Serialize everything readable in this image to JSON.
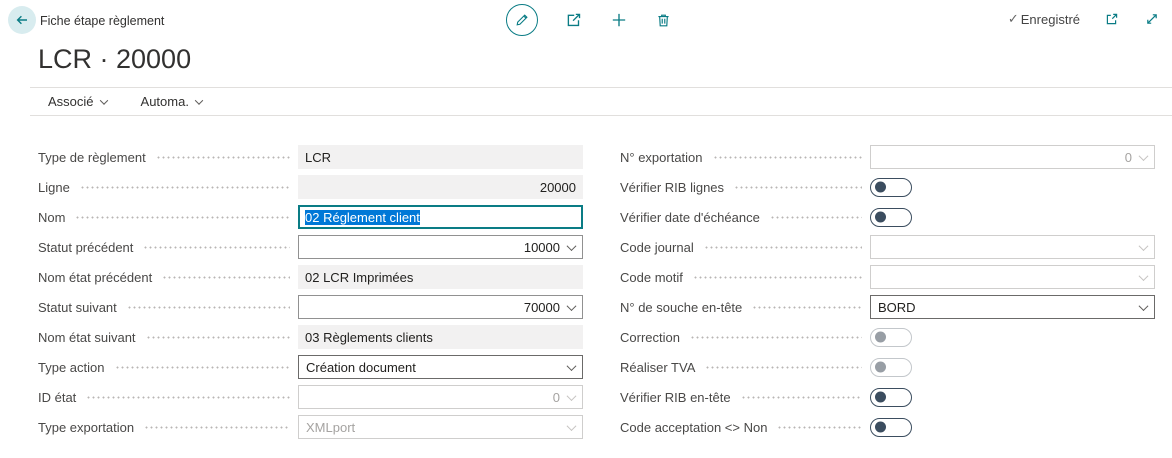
{
  "colors": {
    "accent_teal": "#0a7c85",
    "selection_blue": "#0078d7",
    "toggle_dark": "#3b4d5f",
    "readonly_bg": "#f2f1f1"
  },
  "header": {
    "caption": "Fiche étape règlement",
    "saved_label": "Enregistré",
    "icons": [
      "back-arrow-icon",
      "edit-pencil-icon",
      "share-icon",
      "plus-icon",
      "trash-icon",
      "check-icon",
      "popout-window-icon",
      "expand-diagonal-icon"
    ]
  },
  "page": {
    "title": "LCR · 20000"
  },
  "menu": {
    "items": [
      {
        "label": "Associé"
      },
      {
        "label": "Automa."
      }
    ]
  },
  "fields": {
    "left": [
      {
        "label": "Type de règlement",
        "value": "LCR",
        "type": "readonly"
      },
      {
        "label": "Ligne",
        "value": "20000",
        "type": "readonly",
        "align": "right"
      },
      {
        "label": "Nom",
        "value": "02 Réglement client",
        "type": "text",
        "state": "focused-selected"
      },
      {
        "label": "Statut précédent",
        "value": "10000",
        "type": "combo",
        "align": "right"
      },
      {
        "label": "Nom état précédent",
        "value": "02 LCR Imprimées",
        "type": "readonly"
      },
      {
        "label": "Statut suivant",
        "value": "70000",
        "type": "combo",
        "align": "right"
      },
      {
        "label": "Nom état suivant",
        "value": "03 Règlements clients",
        "type": "readonly"
      },
      {
        "label": "Type action",
        "value": "Création document",
        "type": "combo"
      },
      {
        "label": "ID état",
        "value": "0",
        "type": "combo",
        "align": "right",
        "disabled": true
      },
      {
        "label": "Type exportation",
        "value": "XMLport",
        "type": "combo",
        "disabled": true
      }
    ],
    "right": [
      {
        "label": "N° exportation",
        "value": "0",
        "type": "combo",
        "align": "right",
        "disabled": true
      },
      {
        "label": "Vérifier RIB lignes",
        "value": "off",
        "type": "toggle"
      },
      {
        "label": "Vérifier date d'échéance",
        "value": "off",
        "type": "toggle"
      },
      {
        "label": "Code journal",
        "value": "",
        "type": "combo",
        "disabled": true
      },
      {
        "label": "Code motif",
        "value": "",
        "type": "combo",
        "disabled": true
      },
      {
        "label": "N° de souche en-tête",
        "value": "BORD",
        "type": "combo"
      },
      {
        "label": "Correction",
        "value": "off",
        "type": "toggle",
        "disabled": true
      },
      {
        "label": "Réaliser TVA",
        "value": "off",
        "type": "toggle",
        "disabled": true
      },
      {
        "label": "Vérifier RIB en-tête",
        "value": "off",
        "type": "toggle"
      },
      {
        "label": "Code acceptation <> Non",
        "value": "off",
        "type": "toggle"
      }
    ]
  }
}
